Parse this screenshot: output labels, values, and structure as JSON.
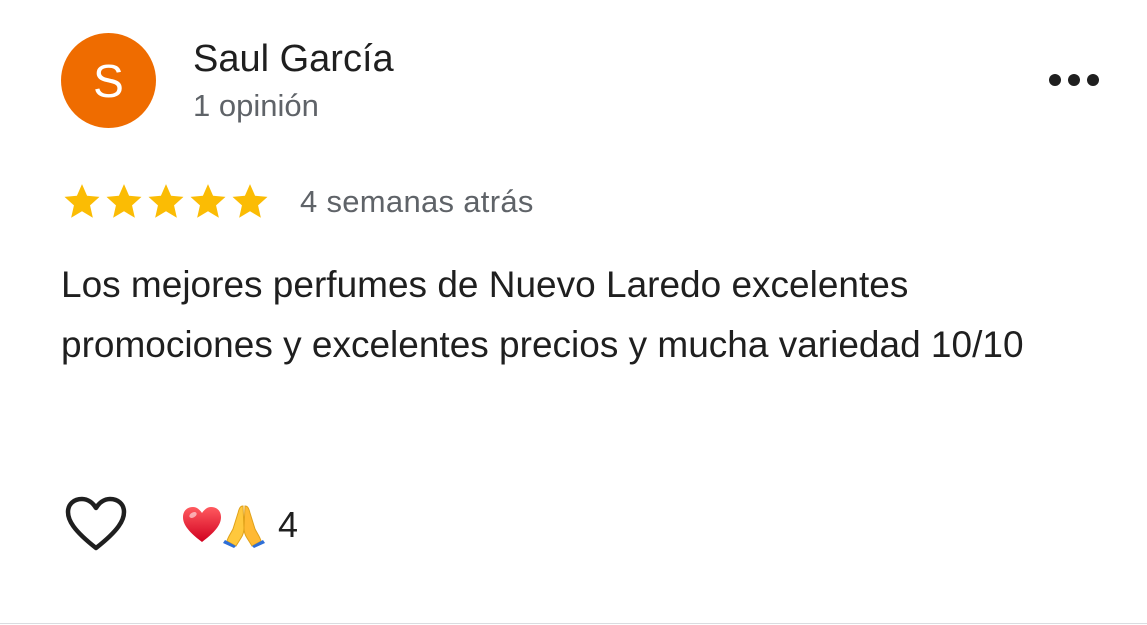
{
  "review": {
    "author": {
      "initial": "S",
      "name": "Saul García",
      "review_count": "1 opinión",
      "avatar_color": "#ef6c00"
    },
    "menu_icon": "more-horizontal-icon",
    "rating": 5,
    "rating_max": 5,
    "star_color": "#fbbc04",
    "date": "4 semanas atrás",
    "text": "Los mejores perfumes de Nuevo Laredo excelentes promociones y excelentes precios y mucha variedad 10/10",
    "like_icon": "heart-outline-icon",
    "reactions": {
      "emojis": [
        "red-heart-emoji",
        "folded-hands-emoji"
      ],
      "count": "4"
    }
  }
}
